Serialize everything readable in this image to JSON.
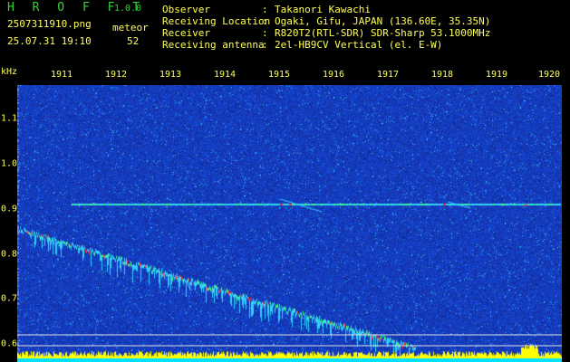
{
  "app": {
    "title": "H R O F F T",
    "version": "1.0.0",
    "file_name": "2507311910.png",
    "datetime": "25.07.31 19:10",
    "meteor_label": "meteor",
    "meteor_count": "52"
  },
  "info": [
    {
      "key": "Observer",
      "sep": ":",
      "value": "Takanori Kawachi"
    },
    {
      "key": "Receiving Location",
      "sep": ":",
      "value": "Ogaki, Gifu, JAPAN (136.60E, 35.35N)"
    },
    {
      "key": "Receiver",
      "sep": ":",
      "value": "R820T2(RTL-SDR) SDR-Sharp 53.1000MHz"
    },
    {
      "key": "Receiving antenna",
      "sep": ":",
      "value": "2el-HB9CV Vertical (el. E-W)"
    }
  ],
  "axes": {
    "unit": "kHz",
    "x_ticks": [
      "1911",
      "1912",
      "1913",
      "1914",
      "1915",
      "1916",
      "1917",
      "1918",
      "1919",
      "1920"
    ],
    "y_ticks": [
      "1.1",
      "1.0",
      "0.9",
      "0.8",
      "0.7",
      "0.6"
    ]
  },
  "chart_data": {
    "type": "heatmap",
    "x_ticks": [
      "1911",
      "1912",
      "1913",
      "1914",
      "1915",
      "1916",
      "1917",
      "1918",
      "1919",
      "1920"
    ],
    "y_ticks": [
      1.1,
      1.0,
      0.9,
      0.8,
      0.7,
      0.6
    ],
    "ylabel": "kHz",
    "traces": [
      {
        "kind": "carrier",
        "freq_khz": 0.91
      },
      {
        "kind": "drifting",
        "from_khz": 0.85,
        "to_khz": 0.58
      }
    ]
  },
  "colors": {
    "background": "#1a2aa0",
    "header_text": "#ffff55",
    "title_text": "#2fd62f",
    "signal_hot": "#ff3030",
    "signal_mid": "#40ff80",
    "signal_cool": "#30d0ff",
    "band_bottom": "#ffff00"
  }
}
